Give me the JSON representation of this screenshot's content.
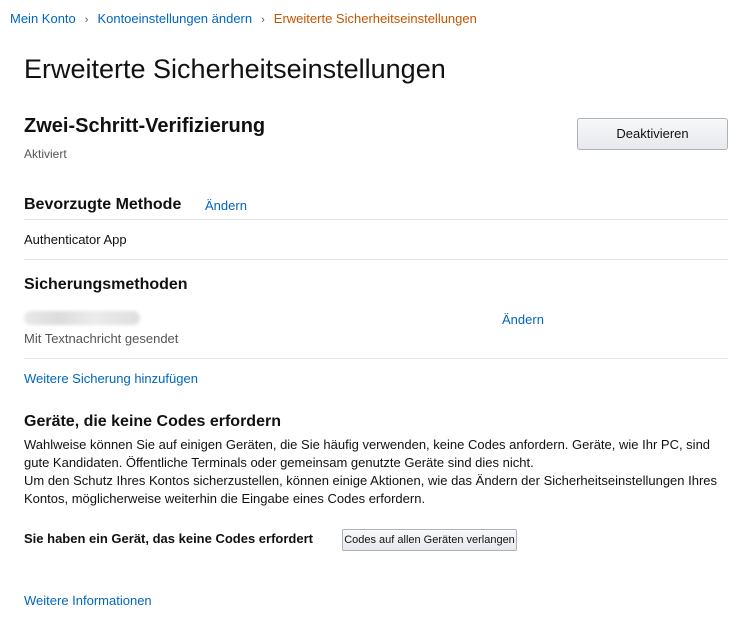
{
  "breadcrumb": {
    "items": [
      "Mein Konto",
      "Kontoeinstellungen ändern"
    ],
    "separator": "›",
    "current": "Erweiterte Sicherheitseinstellungen"
  },
  "page": {
    "title": "Erweiterte Sicherheitseinstellungen"
  },
  "two_step": {
    "title": "Zwei-Schritt-Verifizierung",
    "status": "Aktiviert",
    "deactivate_label": "Deaktivieren"
  },
  "preferred": {
    "title": "Bevorzugte Methode",
    "change_label": "Ändern",
    "value": "Authenticator App"
  },
  "backup": {
    "title": "Sicherungsmethoden",
    "change_label": "Ändern",
    "description": "Mit Textnachricht gesendet",
    "add_label": "Weitere Sicherung hinzufügen"
  },
  "devices": {
    "title": "Geräte, die keine Codes erfordern",
    "paragraph1": "Wahlweise können Sie auf einigen Geräten, die Sie häufig verwenden, keine Codes anfordern. Geräte, wie Ihr PC, sind gute Kandidaten. Öffentliche Terminals oder gemeinsam genutzte Geräte sind dies nicht.",
    "paragraph2": "Um den Schutz Ihres Kontos sicherzustellen, können einige Aktionen, wie das Ändern der Sicherheitseinstellungen Ihres Kontos, möglicherweise weiterhin die Eingabe eines Codes erfordern.",
    "status": "Sie haben ein Gerät, das keine Codes erfordert",
    "require_label": "Codes auf allen Geräten verlangen"
  },
  "footer": {
    "more_info_label": "Weitere Informationen"
  },
  "colors": {
    "link": "#0066c0",
    "breadcrumb_current": "#c45500",
    "muted_text": "#555555",
    "divider": "#e4e4e4"
  }
}
